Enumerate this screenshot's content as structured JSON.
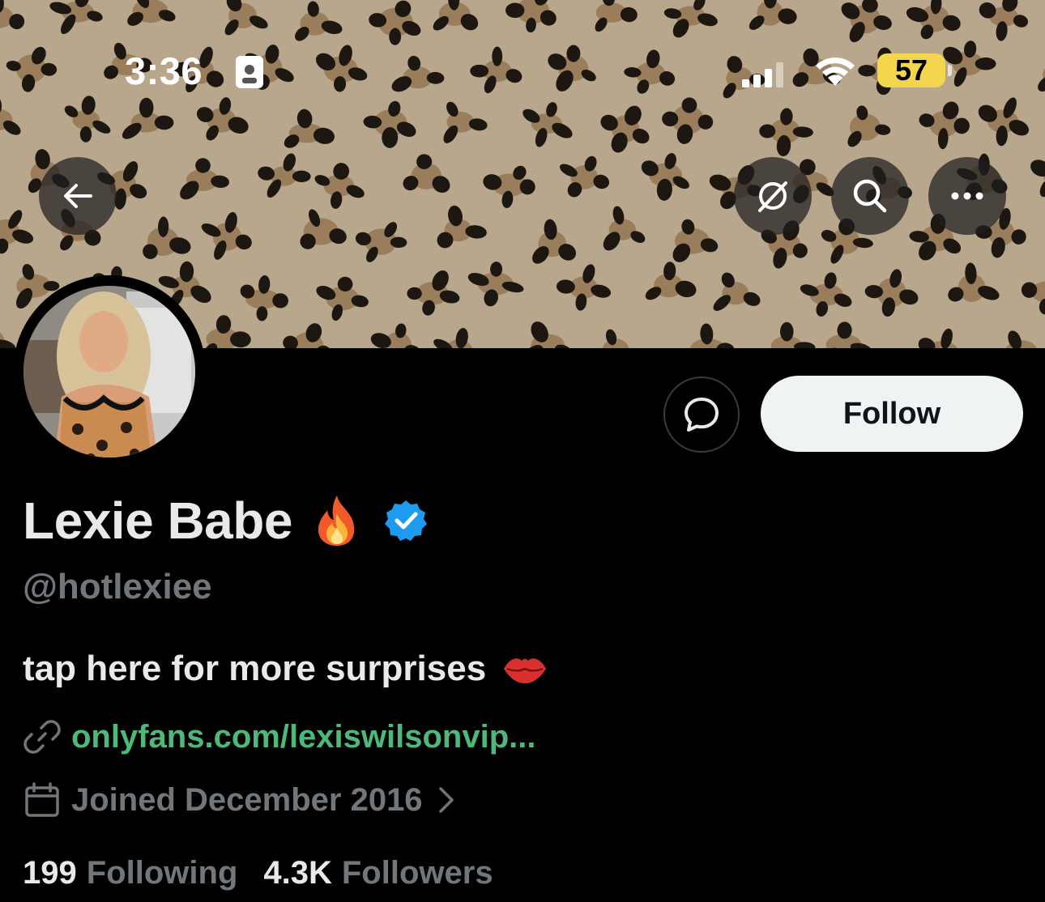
{
  "status_bar": {
    "time": "3:36",
    "battery": "57",
    "battery_color": "#f3d54e"
  },
  "header": {
    "back_icon": "arrow-left-icon",
    "buttons": [
      "grok-icon",
      "search-icon",
      "more-icon"
    ]
  },
  "profile": {
    "display_name": "Lexie Babe",
    "name_emoji_icon": "fire-icon",
    "verified_icon": "verified-badge-icon",
    "verified_color": "#1d9bf0",
    "handle": "@hotlexiee",
    "bio": "tap here for more surprises",
    "bio_emoji_icon": "lips-icon",
    "link": "onlyfans.com/lexiswilsonvip...",
    "link_color": "#4db87a",
    "joined": "Joined December 2016"
  },
  "actions": {
    "message_icon": "message-bubble-icon",
    "follow_label": "Follow"
  },
  "stats": {
    "following_count": "199",
    "following_label": "Following",
    "followers_count": "4.3K",
    "followers_label": "Followers"
  }
}
